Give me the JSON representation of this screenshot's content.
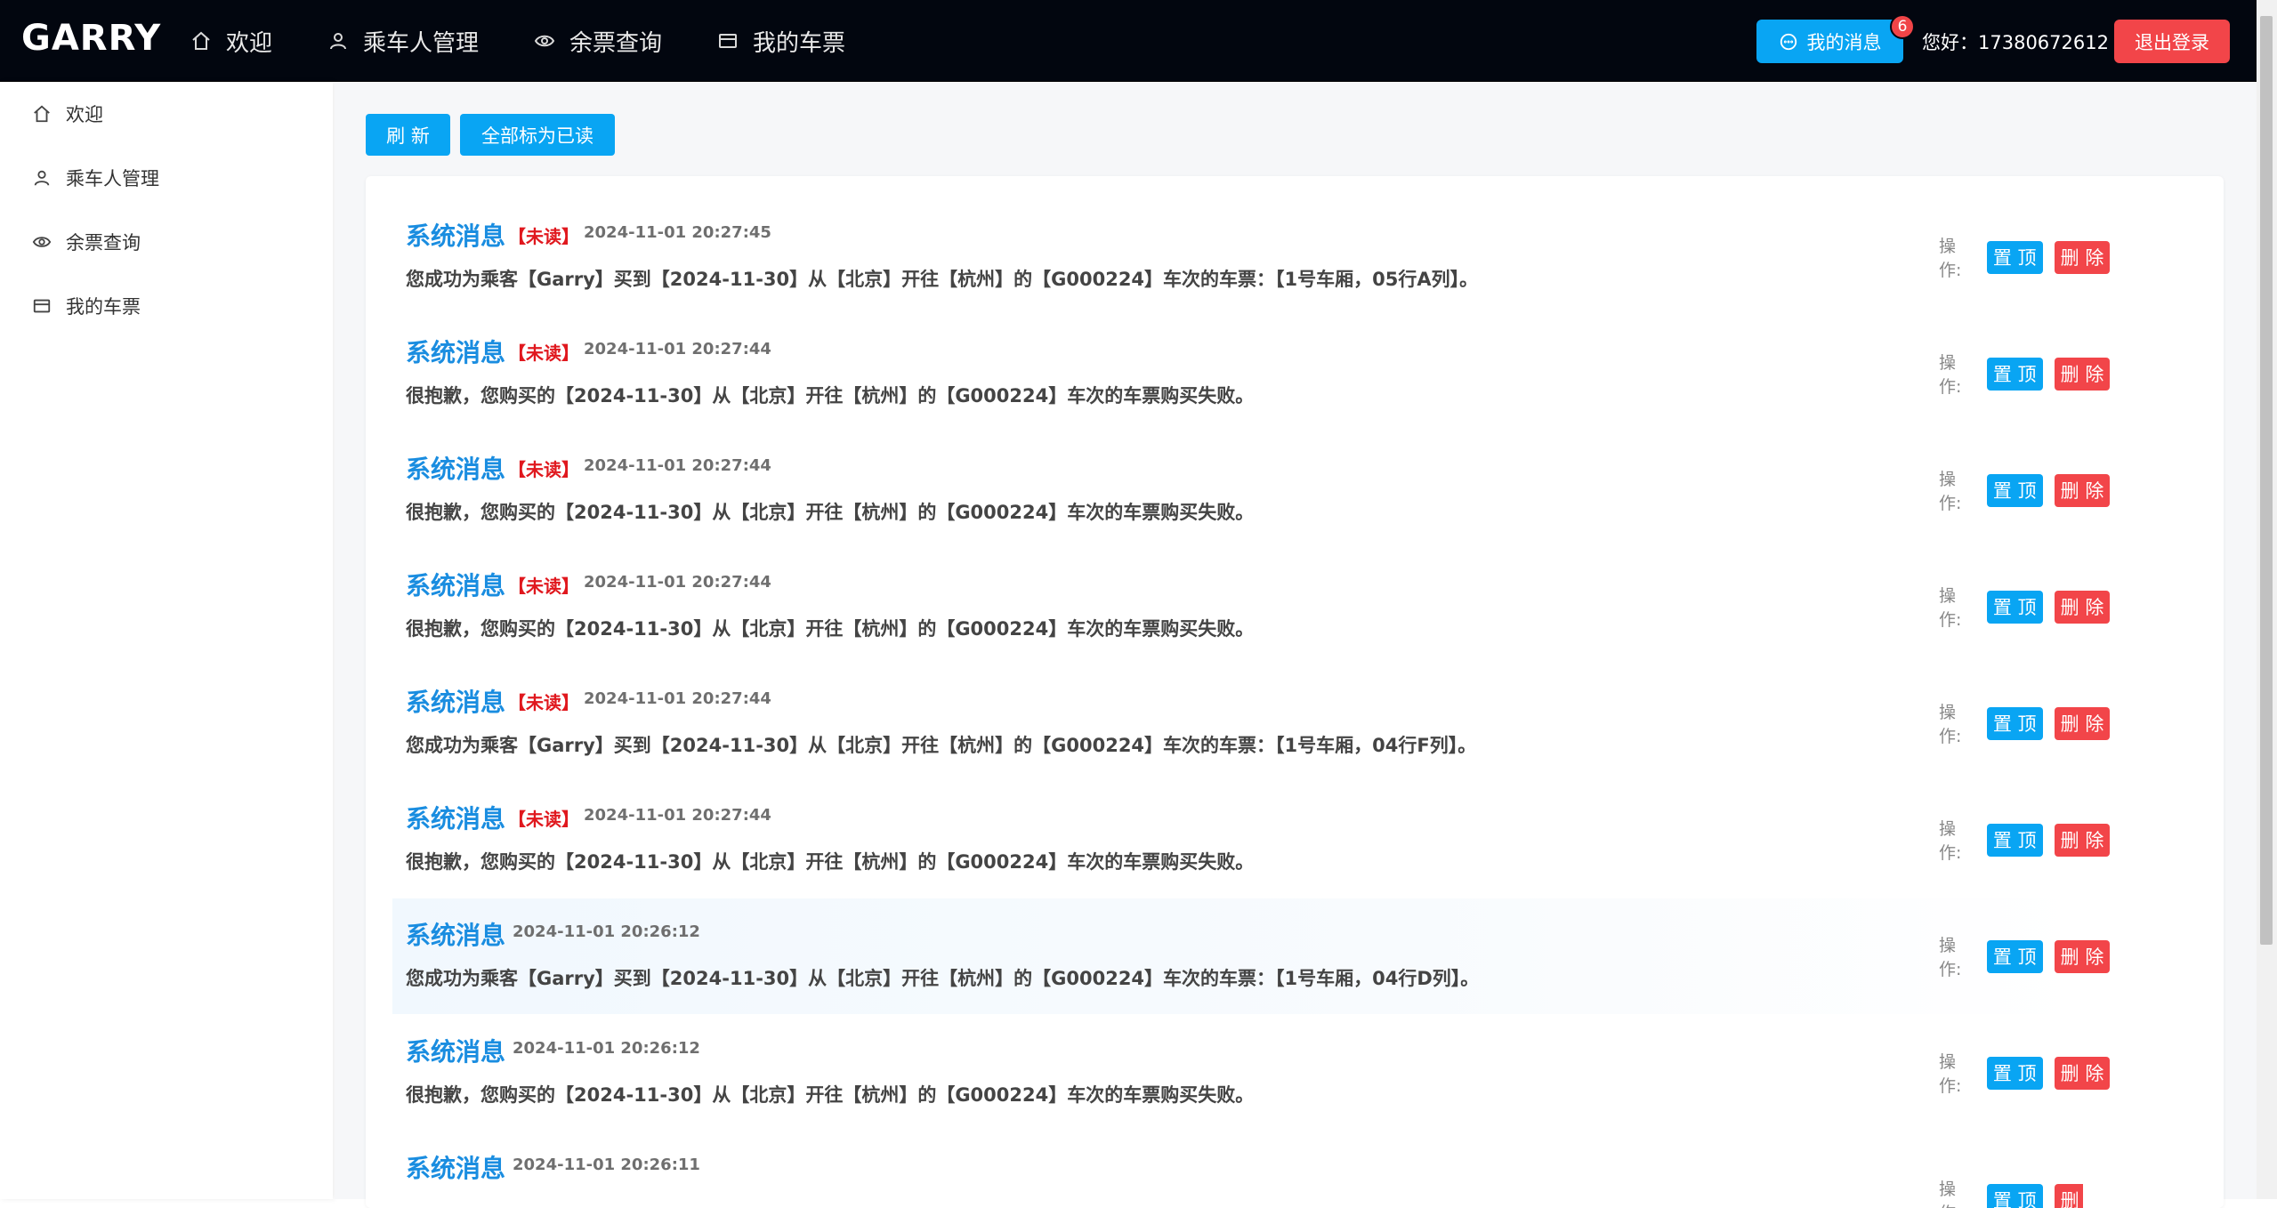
{
  "app": {
    "brand": "GARRY"
  },
  "topnav": [
    {
      "label": "欢迎",
      "icon": "home-icon"
    },
    {
      "label": "乘车人管理",
      "icon": "user-icon"
    },
    {
      "label": "余票查询",
      "icon": "eye-icon"
    },
    {
      "label": "我的车票",
      "icon": "card-icon"
    }
  ],
  "header": {
    "messages_label": "我的消息",
    "badge_count": "6",
    "greeting": "您好：17380672612",
    "logout_label": "退出登录"
  },
  "sidebar": [
    {
      "label": "欢迎",
      "icon": "home-icon"
    },
    {
      "label": "乘车人管理",
      "icon": "user-icon"
    },
    {
      "label": "余票查询",
      "icon": "eye-icon"
    },
    {
      "label": "我的车票",
      "icon": "card-icon"
    }
  ],
  "toolbar": {
    "refresh_label": "刷 新",
    "mark_all_label": "全部标为已读"
  },
  "ops": {
    "label": "操作:",
    "pin_label": "置 顶",
    "delete_label": "删 除"
  },
  "messages": [
    {
      "title": "系统消息",
      "unread": "【未读】",
      "time": "2024-11-01 20:27:45",
      "body": "您成功为乘客【Garry】买到【2024-11-30】从【北京】开往【杭州】的【G000224】车次的车票：【1号车厢，05行A列】。"
    },
    {
      "title": "系统消息",
      "unread": "【未读】",
      "time": "2024-11-01 20:27:44",
      "body": "很抱歉，您购买的【2024-11-30】从【北京】开往【杭州】的【G000224】车次的车票购买失败。"
    },
    {
      "title": "系统消息",
      "unread": "【未读】",
      "time": "2024-11-01 20:27:44",
      "body": "很抱歉，您购买的【2024-11-30】从【北京】开往【杭州】的【G000224】车次的车票购买失败。"
    },
    {
      "title": "系统消息",
      "unread": "【未读】",
      "time": "2024-11-01 20:27:44",
      "body": "很抱歉，您购买的【2024-11-30】从【北京】开往【杭州】的【G000224】车次的车票购买失败。"
    },
    {
      "title": "系统消息",
      "unread": "【未读】",
      "time": "2024-11-01 20:27:44",
      "body": "您成功为乘客【Garry】买到【2024-11-30】从【北京】开往【杭州】的【G000224】车次的车票：【1号车厢，04行F列】。"
    },
    {
      "title": "系统消息",
      "unread": "【未读】",
      "time": "2024-11-01 20:27:44",
      "body": "很抱歉，您购买的【2024-11-30】从【北京】开往【杭州】的【G000224】车次的车票购买失败。"
    },
    {
      "title": "系统消息",
      "unread": "",
      "time": "2024-11-01 20:26:12",
      "body": "您成功为乘客【Garry】买到【2024-11-30】从【北京】开往【杭州】的【G000224】车次的车票：【1号车厢，04行D列】。"
    },
    {
      "title": "系统消息",
      "unread": "",
      "time": "2024-11-01 20:26:12",
      "body": "很抱歉，您购买的【2024-11-30】从【北京】开往【杭州】的【G000224】车次的车票购买失败。"
    },
    {
      "title": "系统消息",
      "unread": "",
      "time": "2024-11-01 20:26:11",
      "body": ""
    }
  ],
  "colors": {
    "accent": "#09a5f3",
    "danger": "#f24549",
    "title": "#1a8de0",
    "unread": "#e0181e",
    "topbar": "#02060f"
  }
}
